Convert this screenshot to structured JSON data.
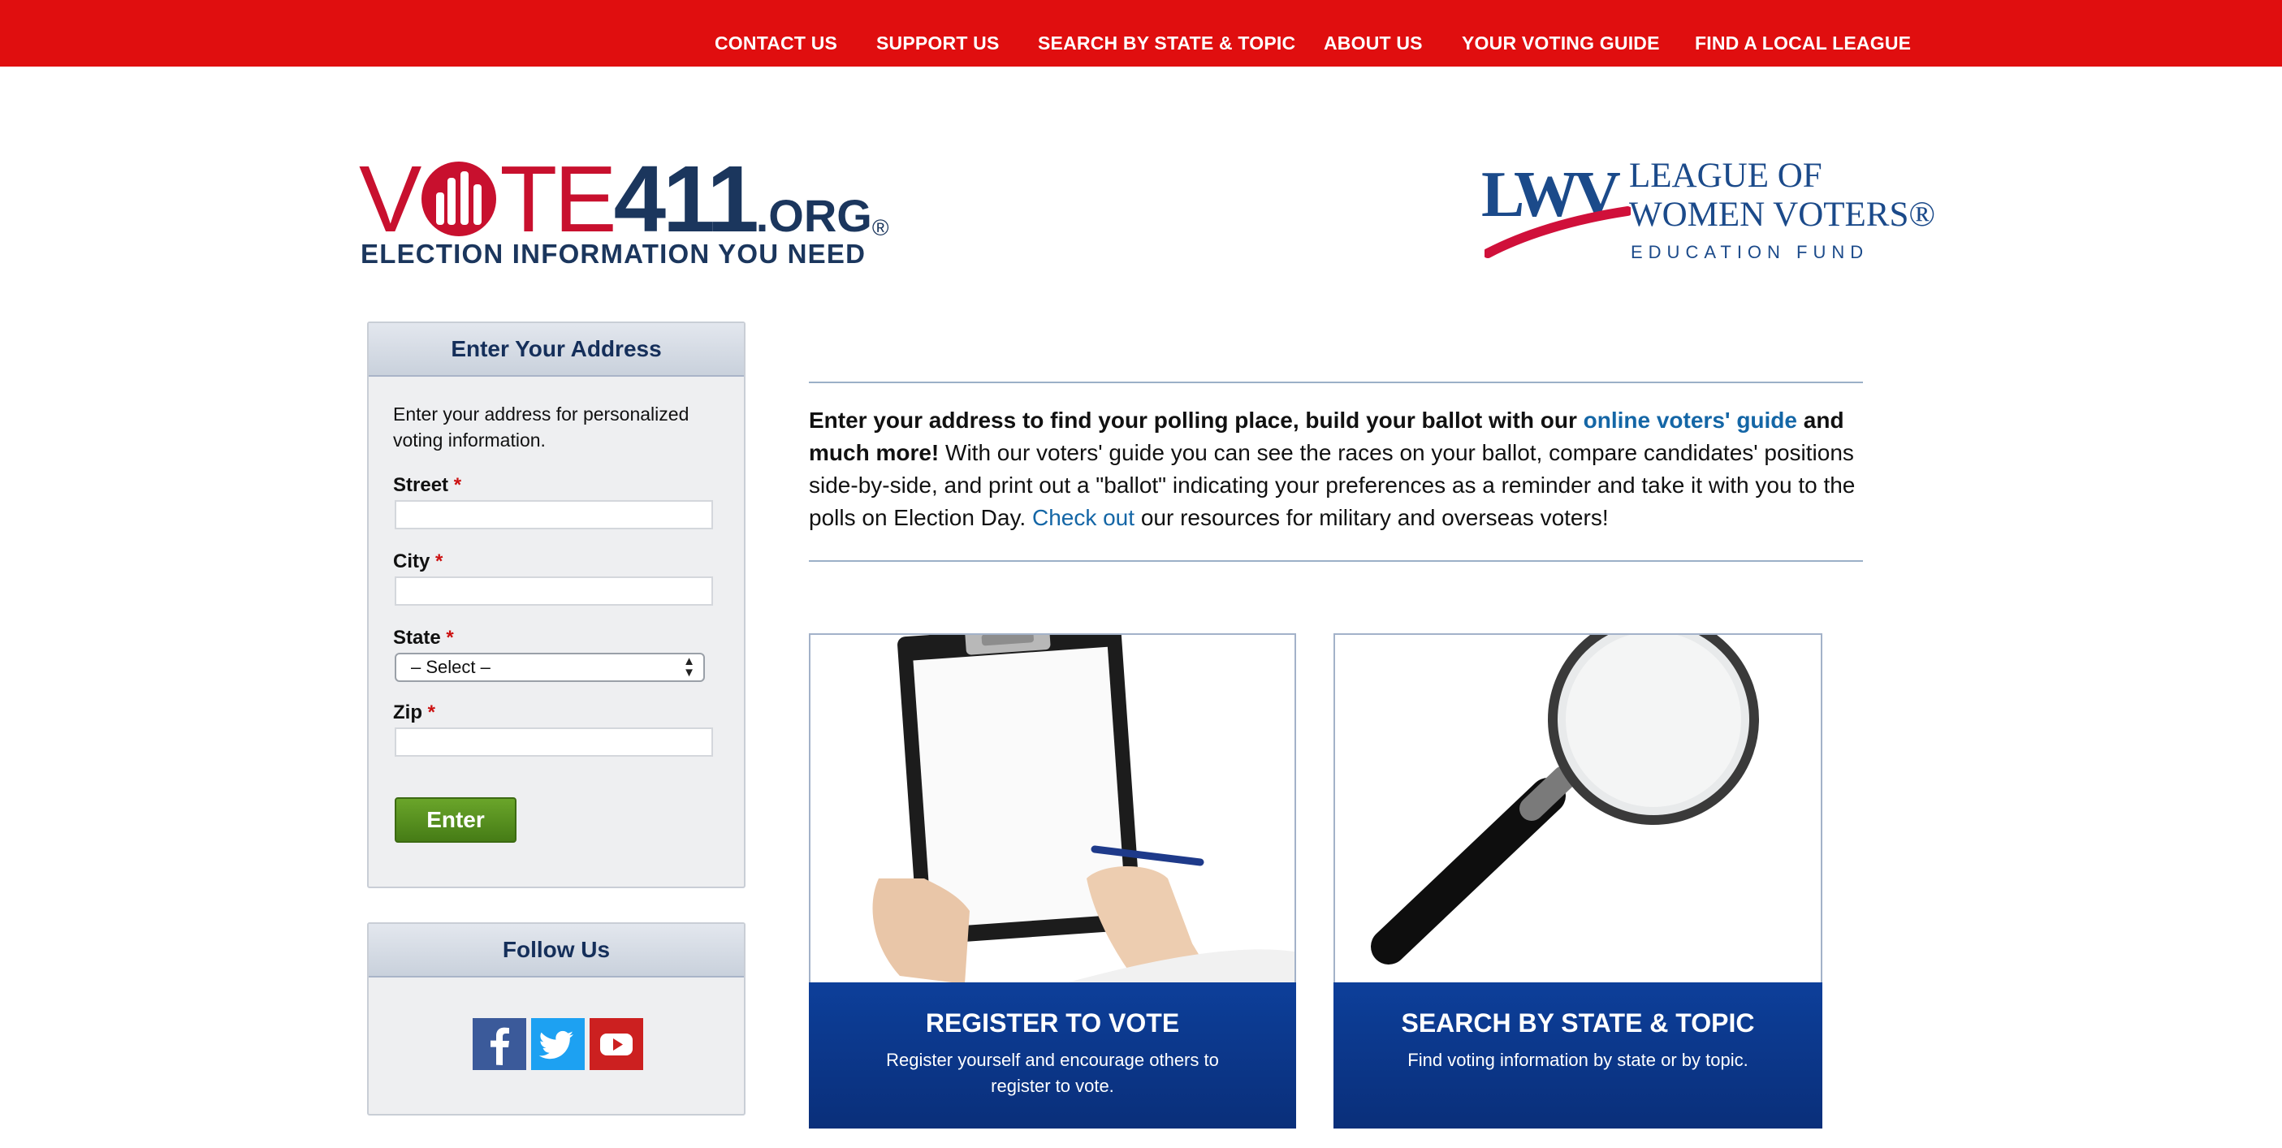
{
  "nav": {
    "items": [
      "CONTACT US",
      "SUPPORT US",
      "SEARCH BY STATE & TOPIC",
      "ABOUT US",
      "YOUR VOTING GUIDE",
      "FIND A LOCAL LEAGUE"
    ]
  },
  "brand": {
    "vote411": {
      "part1": "V",
      "part2": "TE",
      "part3": "411",
      "part4": ".ORG",
      "reg": "®",
      "tagline": "ELECTION INFORMATION YOU NEED"
    },
    "lwv": {
      "mark": "LWV",
      "line1": "LEAGUE OF",
      "line2": "WOMEN VOTERS®",
      "line3": "EDUCATION FUND"
    }
  },
  "address_form": {
    "title": "Enter Your Address",
    "intro": "Enter your address for personalized voting information.",
    "required_mark": "*",
    "street_label": "Street",
    "city_label": "City",
    "state_label": "State",
    "state_value": "– Select –",
    "zip_label": "Zip",
    "submit_label": "Enter"
  },
  "follow": {
    "title": "Follow Us",
    "icons": [
      "facebook-icon",
      "twitter-icon",
      "youtube-icon"
    ]
  },
  "intro": {
    "bold_lead": "Enter your address to find your polling place, build your ballot with our",
    "link_guide": "online voters' guide",
    "bold_tail": "and much more!",
    "body1": "With our voters' guide you can see the races on your ballot, compare candidates' positions side-by-side, and print out a \"ballot\" indicating your preferences as a reminder and take it with you to the polls on Election Day.",
    "link_check": "Check out",
    "body2": "our resources for military and overseas voters!"
  },
  "cards": [
    {
      "title": "REGISTER TO VOTE",
      "desc": "Register yourself and encourage others to register to vote."
    },
    {
      "title": "SEARCH BY STATE & TOPIC",
      "desc": "Find voting information by state or by topic."
    }
  ],
  "colors": {
    "nav_red": "#e00e0f",
    "brand_navy": "#1b365d",
    "brand_red": "#c8102e",
    "link_blue": "#1466a6",
    "card_blue": "#0d3f9a",
    "button_green": "#5a951f"
  }
}
